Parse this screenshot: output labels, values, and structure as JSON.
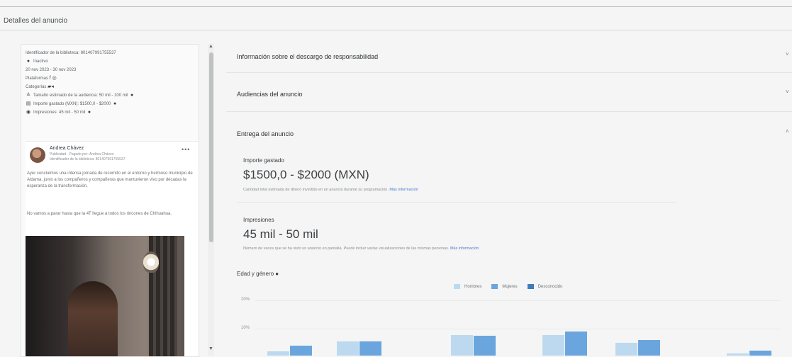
{
  "page": {
    "title": "Detalles del anuncio"
  },
  "ad_meta": {
    "library_id": "Identificador de la biblioteca: 801407991755537",
    "status": "Inactivo",
    "dates": "20 nov 2023 - 30 nov 2023",
    "platforms": "Plataformas",
    "categories": "Categorías",
    "audience_size": "Tamaño estimado de la audiencia: 50 mil - 100 mil",
    "amount_spent": "Importe gastado (MXN): $1500,0 - $2000",
    "impressions": "Impresiones: 45 mil - 50 mil"
  },
  "post": {
    "author": "Andrea Chávez",
    "sponsor": "Publicidad · Pagado por: Andrea Chávez",
    "library_id": "Identificador de la biblioteca: 801407991755537",
    "menu": "•••",
    "text_1": "Ayer concluimos una intensa jornada de recorrido en el entorno y hermoso municipio de Aldama, junto a los compañeros y compañeras que mantuvieron vivo por décadas la esperanza de la transformación.",
    "text_2": "No vamos a parar hasta que la 4T llegue a todos los rincones de Chihuahua."
  },
  "sections": {
    "disclaimer": "Información sobre el descargo de responsabilidad",
    "audiences": "Audiencias del anuncio",
    "delivery": "Entrega del anuncio",
    "chev_down": "˅",
    "chev_up": "˄"
  },
  "delivery": {
    "spent_label": "Importe gastado",
    "spent_value": "$1500,0 - $2000 (MXN)",
    "spent_note": "Cantidad total estimada de dinero invertido en un anuncio durante su programación.",
    "spent_link": "Más información",
    "impressions_label": "Impresiones",
    "impressions_value": "45 mil - 50 mil",
    "impressions_note": "Número de veces que se ha visto un anuncio en pantalla. Puede incluir varias visualizaciones de las mismas personas.",
    "impressions_link": "Más información",
    "age_gender_label": "Edad y género"
  },
  "chart_data": {
    "type": "bar",
    "title": "",
    "ylabel": "",
    "ylim": [
      0,
      25
    ],
    "yticks": [
      "20%",
      "10%"
    ],
    "categories": [
      "",
      "",
      "",
      "",
      "",
      ""
    ],
    "series": [
      {
        "name": "Hombres",
        "color": "#bcd9f0",
        "values": [
          1.5,
          5.0,
          7.2,
          7.3,
          4.5,
          0.8
        ]
      },
      {
        "name": "Mujeres",
        "color": "#6aa6dd",
        "values": [
          3.5,
          5.0,
          7.1,
          8.5,
          5.6,
          1.8
        ]
      },
      {
        "name": "Desconocido",
        "color": "#3f7cba",
        "values": [
          0,
          0,
          0,
          0,
          0,
          0
        ]
      }
    ]
  },
  "icons": {
    "status": "●",
    "platforms": "f ◎",
    "categories": "▰◂",
    "audience": "≗",
    "spent": "▤",
    "impressions": "◉"
  }
}
